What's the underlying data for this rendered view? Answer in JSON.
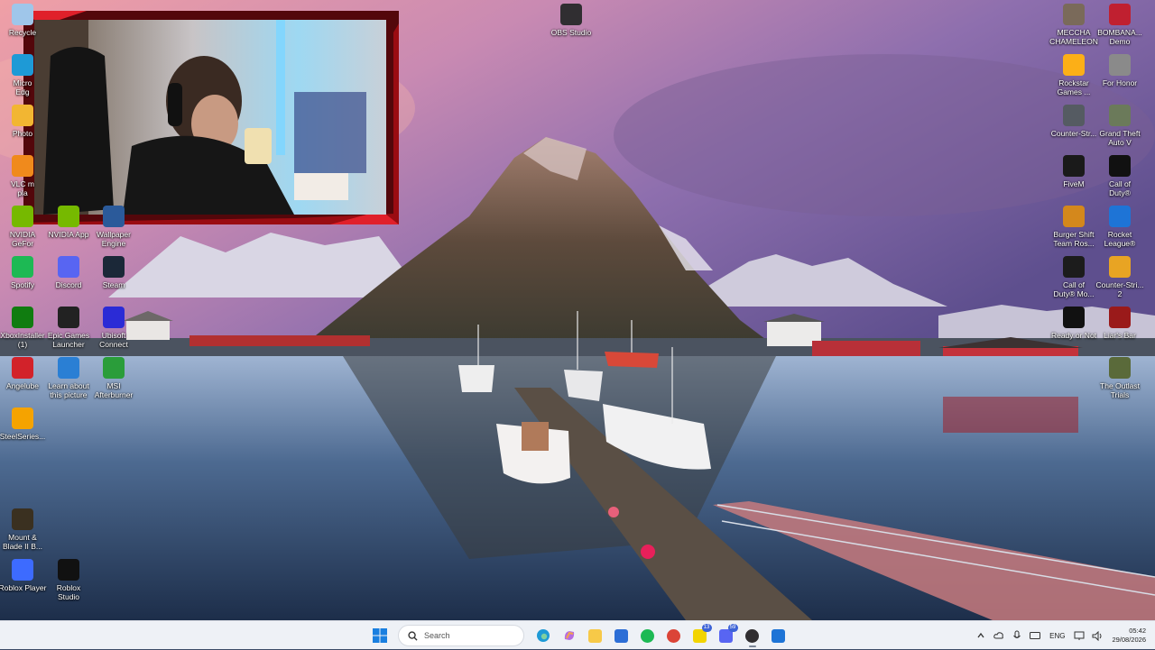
{
  "desktop": {
    "left_column_1": [
      {
        "label": "Recycle",
        "icon": "recycle-bin-icon",
        "color": "#9fc6ea"
      },
      {
        "label": "Micro\nEdg",
        "icon": "edge-icon",
        "color": "#1e9ad6"
      },
      {
        "label": "Photo",
        "icon": "photos-icon",
        "color": "#f2b632"
      },
      {
        "label": "VLC m\npla",
        "icon": "vlc-icon",
        "color": "#f08a1c"
      },
      {
        "label": "NVIDIA\nGeFor",
        "icon": "nvidia-icon",
        "color": "#76b900"
      },
      {
        "label": "Spotify",
        "icon": "spotify-icon",
        "color": "#1db954"
      },
      {
        "label": "XboxInstaller\n(1)",
        "icon": "xbox-icon",
        "color": "#107c10"
      },
      {
        "label": "Angelube",
        "icon": "angelube-icon",
        "color": "#d2222a"
      },
      {
        "label": "SteelSeries...",
        "icon": "steelseries-icon",
        "color": "#f5a300"
      },
      {
        "label": "Mount &\nBlade II B...",
        "icon": "bannerlord-icon",
        "color": "#3a3020"
      },
      {
        "label": "Roblox Player",
        "icon": "roblox-player-icon",
        "color": "#3d6bff"
      }
    ],
    "left_column_2": [
      {
        "label": "NVIDIA App",
        "icon": "nvidia-app-icon",
        "color": "#76b900"
      },
      {
        "label": "Discord",
        "icon": "discord-icon",
        "color": "#5865f2"
      },
      {
        "label": "Epic Games\nLauncher",
        "icon": "epic-games-icon",
        "color": "#222222"
      },
      {
        "label": "Learn about\nthis picture",
        "icon": "learn-picture-icon",
        "color": "#2a7fd4"
      },
      {
        "label": "Roblox\nStudio",
        "icon": "roblox-studio-icon",
        "color": "#111111"
      }
    ],
    "left_column_3": [
      {
        "label": "Wallpaper\nEngine",
        "icon": "wallpaper-engine-icon",
        "color": "#2b5a9a"
      },
      {
        "label": "Steam",
        "icon": "steam-icon",
        "color": "#1b2838"
      },
      {
        "label": "Ubisoft\nConnect",
        "icon": "ubisoft-icon",
        "color": "#2b2bd6"
      },
      {
        "label": "MSI\nAfterburner",
        "icon": "msi-afterburner-icon",
        "color": "#2a9d3a"
      }
    ],
    "center": {
      "label": "OBS Studio",
      "icon": "obs-icon",
      "color": "#302e31"
    },
    "right_column_1": [
      {
        "label": "MECCHA\nCHAMELEON",
        "icon": "meccha-chameleon-icon",
        "color": "#7a6a5a"
      },
      {
        "label": "Rockstar\nGames ...",
        "icon": "rockstar-icon",
        "color": "#fcaf17"
      },
      {
        "label": "Counter-Str...",
        "icon": "counter-strike-icon",
        "color": "#555b62"
      },
      {
        "label": "FiveM",
        "icon": "fivem-icon",
        "color": "#1a1a1a"
      },
      {
        "label": "Burger Shift\nTeam Ros...",
        "icon": "burger-shift-icon",
        "color": "#d4881c"
      },
      {
        "label": "Call of\nDuty® Mo...",
        "icon": "call-of-duty-mw-icon",
        "color": "#1c1c1c"
      },
      {
        "label": "Ready or Not",
        "icon": "ready-or-not-icon",
        "color": "#111111"
      }
    ],
    "right_column_2": [
      {
        "label": "BOMBANA...\nDemo",
        "icon": "bombana-icon",
        "color": "#c02030"
      },
      {
        "label": "For Honor",
        "icon": "for-honor-icon",
        "color": "#8a8a8a"
      },
      {
        "label": "Grand Theft\nAuto V",
        "icon": "gta-v-icon",
        "color": "#6b7a5a"
      },
      {
        "label": "Call of\nDuty®",
        "icon": "call-of-duty-icon",
        "color": "#111111"
      },
      {
        "label": "Rocket\nLeague®",
        "icon": "rocket-league-icon",
        "color": "#1e74d6"
      },
      {
        "label": "Counter-Stri...\n2",
        "icon": "counter-strike-2-icon",
        "color": "#e8a423"
      },
      {
        "label": "Liar's Bar",
        "icon": "liars-bar-icon",
        "color": "#9a1a1a"
      },
      {
        "label": "The Outlast\nTrials",
        "icon": "outlast-trials-icon",
        "color": "#5a6a3a"
      }
    ]
  },
  "taskbar": {
    "search_placeholder": "Search",
    "apps": [
      {
        "name": "file-explorer",
        "icon": "folder-icon",
        "color": "#f7c948"
      },
      {
        "name": "microsoft-store",
        "icon": "store-icon",
        "color": "#2d6ed6"
      },
      {
        "name": "spotify",
        "icon": "spotify-icon",
        "color": "#1db954"
      },
      {
        "name": "chrome",
        "icon": "chrome-icon",
        "color": "#db4437"
      },
      {
        "name": "whatsapp-like",
        "icon": "notify-app-icon",
        "color": "#f2d400",
        "badge": "13"
      },
      {
        "name": "discord",
        "icon": "discord-icon",
        "color": "#5865f2",
        "badge": "59"
      },
      {
        "name": "obs",
        "icon": "obs-icon",
        "color": "#302e31",
        "active": true
      },
      {
        "name": "rocket-league",
        "icon": "shield-app-icon",
        "color": "#1e74d6"
      }
    ],
    "tray": {
      "language": "ENG",
      "time": "05:42",
      "date": "29/08/2026"
    }
  }
}
